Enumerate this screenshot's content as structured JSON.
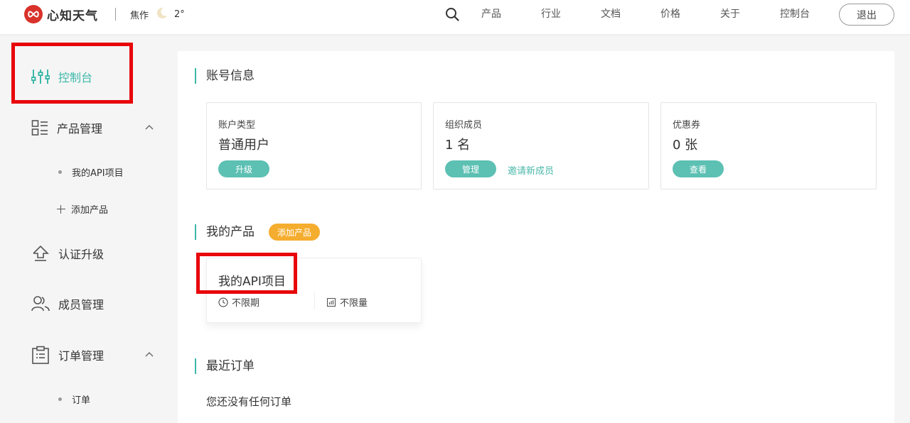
{
  "header": {
    "brand": "心知天气",
    "city": "焦作",
    "temperature": "2°",
    "nav": [
      "产品",
      "行业",
      "文档",
      "价格",
      "关于",
      "控制台"
    ],
    "logout_label": "退出"
  },
  "sidebar": {
    "dashboard_label": "控制台",
    "products": {
      "label": "产品管理",
      "items": [
        "我的API项目"
      ],
      "add_label": "添加产品"
    },
    "certify_label": "认证升级",
    "members_label": "成员管理",
    "orders": {
      "label": "订单管理",
      "items": [
        "订单"
      ]
    }
  },
  "account": {
    "title": "账号信息",
    "type": {
      "label": "账户类型",
      "value": "普通用户",
      "action": "升级"
    },
    "members": {
      "label": "组织成员",
      "value": "1 名",
      "action": "管理",
      "link": "邀请新成员"
    },
    "coupons": {
      "label": "优惠券",
      "value": "0 张",
      "action": "查看"
    }
  },
  "products": {
    "title": "我的产品",
    "add_badge": "添加产品",
    "card": {
      "name": "我的API项目",
      "period": "不限期",
      "quota": "不限量"
    }
  },
  "orders": {
    "title": "最近订单",
    "empty": "您还没有任何订单"
  },
  "colors": {
    "accent": "#3db8a9",
    "warning": "#f5ad2f",
    "highlight": "#e8060a",
    "brand": "#d9322b"
  }
}
